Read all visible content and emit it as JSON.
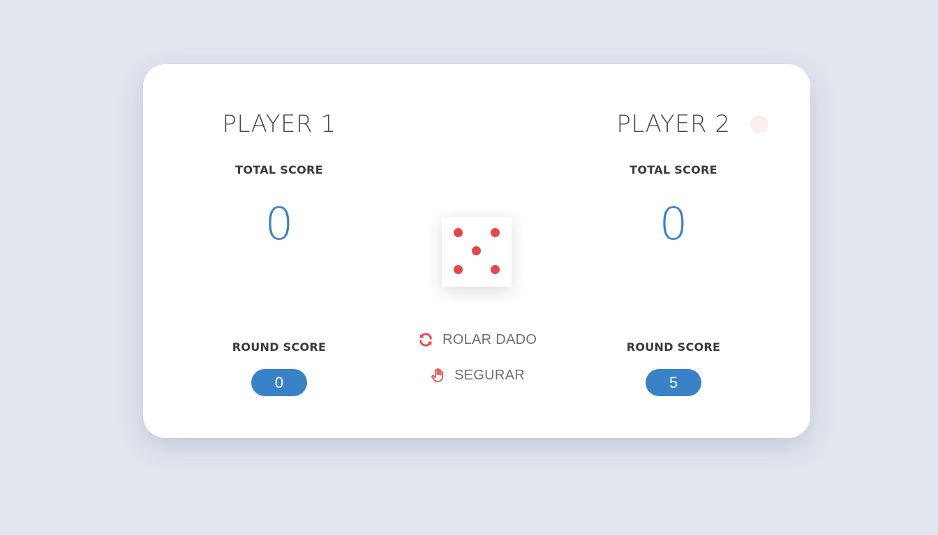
{
  "players": [
    {
      "name": "PLAYER 1",
      "total_label": "TOTAL SCORE",
      "total_score": "0",
      "round_label": "ROUND SCORE",
      "round_score": "0",
      "active": false
    },
    {
      "name": "PLAYER 2",
      "total_label": "TOTAL SCORE",
      "total_score": "0",
      "round_label": "ROUND SCORE",
      "round_score": "5",
      "active": true
    }
  ],
  "dice": {
    "value": 5
  },
  "controls": {
    "roll_label": "ROLAR DADO",
    "roll_icon": "refresh-icon",
    "hold_label": "SEGURAR",
    "hold_icon": "hand-icon"
  },
  "colors": {
    "accent": "#3a82c8",
    "pip": "#e5484a",
    "background": "#e1e5ee",
    "active_indicator": "#fdeeee"
  }
}
